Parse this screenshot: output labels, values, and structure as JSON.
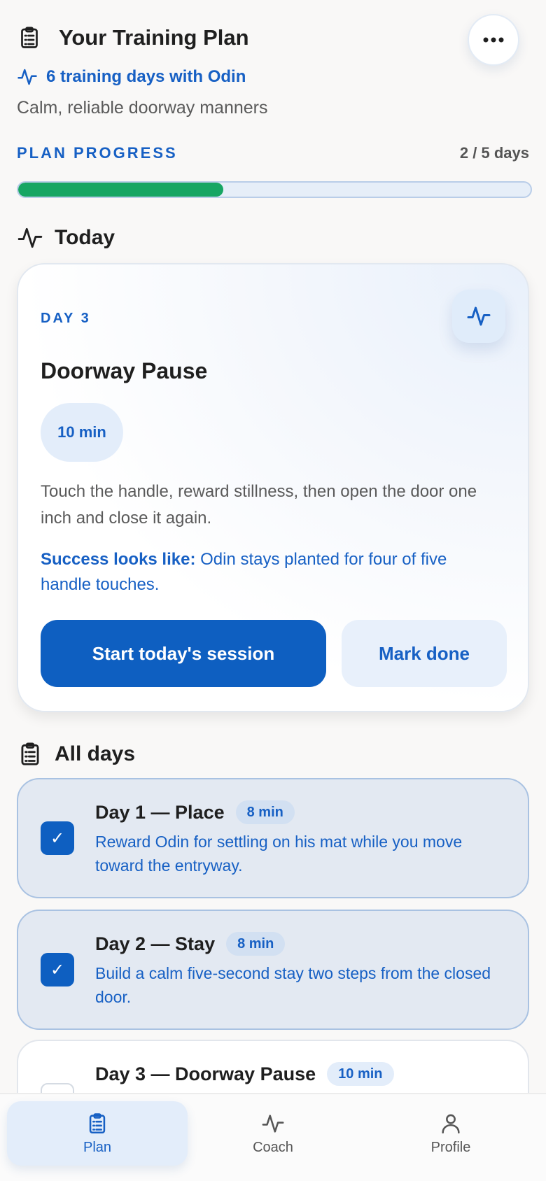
{
  "header": {
    "title": "Your Training Plan",
    "days_label": "6 training days with Odin",
    "goal": "Calm, reliable doorway manners"
  },
  "progress": {
    "label": "PLAN PROGRESS",
    "count": "2 / 5 days",
    "fraction": 0.4
  },
  "today": {
    "heading": "Today",
    "day_label": "DAY 3",
    "title": "Doorway Pause",
    "duration": "10 min",
    "description": "Touch the handle, reward stillness, then open the door one inch and close it again.",
    "success_label": "Success looks like:",
    "success_text": "Odin stays planted for four of five handle touches.",
    "start_label": "Start today's session",
    "done_label": "Mark done"
  },
  "all_days": {
    "heading": "All days",
    "items": [
      {
        "name": "Day 1 — Place",
        "duration": "8 min",
        "desc": "Reward Odin for settling on his mat while you move toward the entryway.",
        "done": true,
        "check": "✓"
      },
      {
        "name": "Day 2 — Stay",
        "duration": "8 min",
        "desc": "Build a calm five-second stay two steps from the closed door.",
        "done": true,
        "check": "✓"
      },
      {
        "name": "Day 3 — Doorway Pause",
        "duration": "10 min",
        "desc": "",
        "done": false
      }
    ]
  },
  "tabs": [
    {
      "label": "Plan",
      "icon": "clipboard-icon",
      "active": true
    },
    {
      "label": "Coach",
      "icon": "pulse-icon",
      "active": false
    },
    {
      "label": "Profile",
      "icon": "user-icon",
      "active": false
    }
  ],
  "colors": {
    "accent": "#1760c4",
    "primary_button": "#0e5fc1",
    "progress_fill": "#17a663"
  }
}
